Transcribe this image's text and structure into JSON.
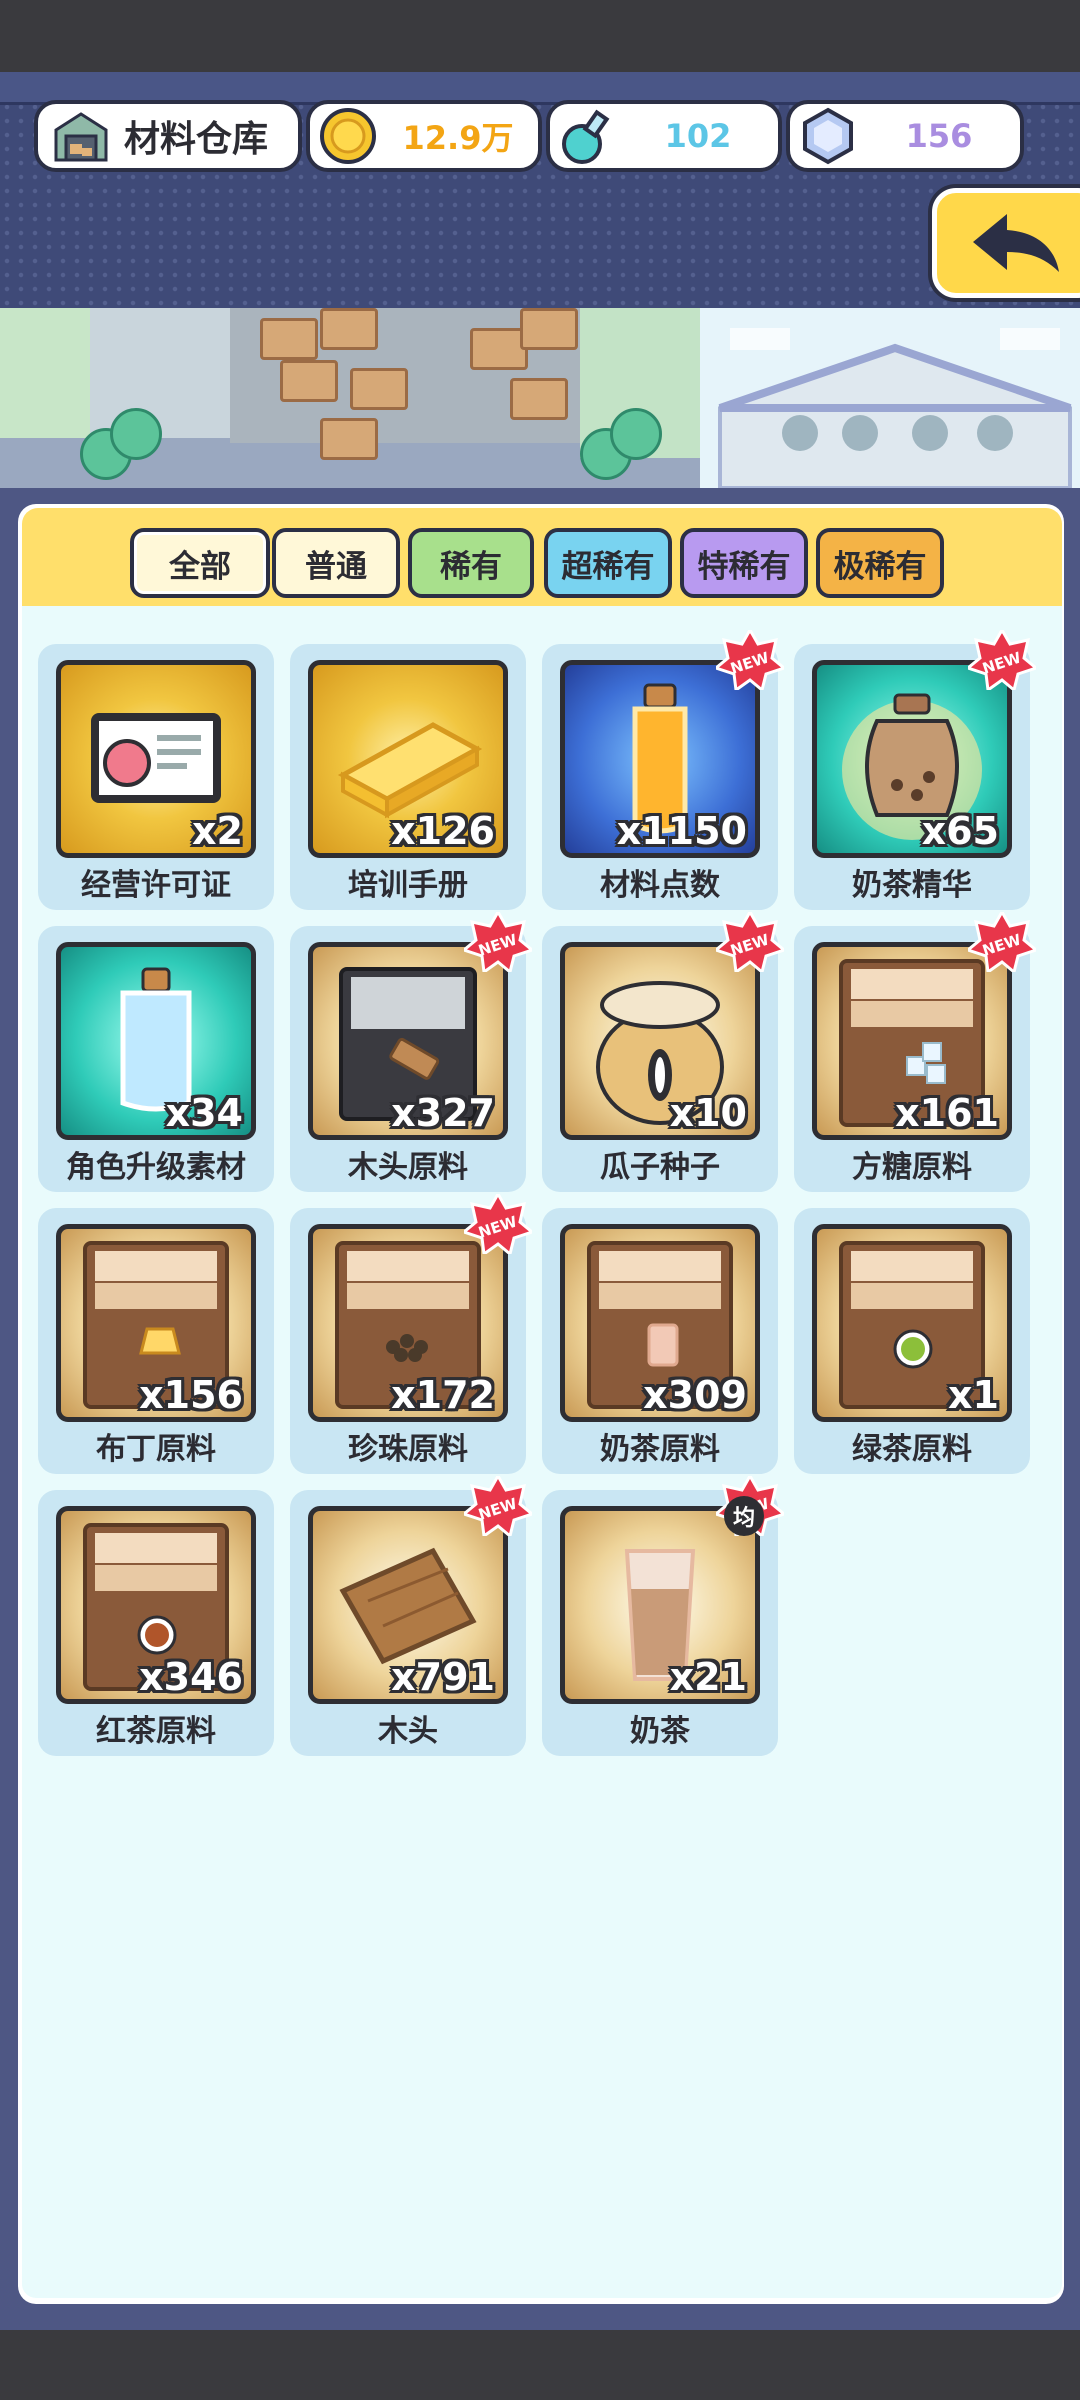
{
  "header": {
    "title": "材料仓库",
    "coins": "12.9万",
    "potion": "102",
    "gems": "156",
    "colors": {
      "coins": "#f3a514",
      "potion": "#5cc6e6",
      "gems": "#a98de0"
    }
  },
  "tabs": [
    {
      "label": "全部",
      "color": "#fff8d8"
    },
    {
      "label": "普通",
      "color": "#fff8d8"
    },
    {
      "label": "稀有",
      "color": "#a8e08c"
    },
    {
      "label": "超稀有",
      "color": "#79d3f0"
    },
    {
      "label": "特稀有",
      "color": "#b89af0"
    },
    {
      "label": "极稀有",
      "color": "#f4b346"
    }
  ],
  "items": [
    {
      "name": "经营许可证",
      "qty": "x2",
      "bg": "gold",
      "icon": "license-card-icon",
      "new": false
    },
    {
      "name": "培训手册",
      "qty": "x126",
      "bg": "gold",
      "icon": "gold-book-icon",
      "new": false
    },
    {
      "name": "材料点数",
      "qty": "x1150",
      "bg": "blue",
      "icon": "orange-bottle-icon",
      "new": true
    },
    {
      "name": "奶茶精华",
      "qty": "x65",
      "bg": "teal",
      "icon": "jar-icon",
      "new": true
    },
    {
      "name": "角色升级素材",
      "qty": "x34",
      "bg": "teal",
      "icon": "blue-bottle-icon",
      "new": false
    },
    {
      "name": "木头原料",
      "qty": "x327",
      "bg": "tan",
      "icon": "wood-crate-icon",
      "new": true
    },
    {
      "name": "瓜子种子",
      "qty": "x10",
      "bg": "tan",
      "icon": "seed-sack-icon",
      "new": true
    },
    {
      "name": "方糖原料",
      "qty": "x161",
      "bg": "tan",
      "icon": "sugar-box-icon",
      "new": true
    },
    {
      "name": "布丁原料",
      "qty": "x156",
      "bg": "tan",
      "icon": "pudding-box-icon",
      "new": false
    },
    {
      "name": "珍珠原料",
      "qty": "x172",
      "bg": "tan",
      "icon": "pearl-box-icon",
      "new": true
    },
    {
      "name": "奶茶原料",
      "qty": "x309",
      "bg": "tan",
      "icon": "milktea-box-icon",
      "new": false
    },
    {
      "name": "绿茶原料",
      "qty": "x1",
      "bg": "tan",
      "icon": "greentea-box-icon",
      "new": false
    },
    {
      "name": "红茶原料",
      "qty": "x346",
      "bg": "tan",
      "icon": "blacktea-box-icon",
      "new": false
    },
    {
      "name": "木头",
      "qty": "x791",
      "bg": "tan",
      "icon": "wood-plank-icon",
      "new": true
    },
    {
      "name": "奶茶",
      "qty": "x21",
      "bg": "tan",
      "icon": "milk-tea-glass-icon",
      "new": true,
      "badge": "均"
    }
  ]
}
